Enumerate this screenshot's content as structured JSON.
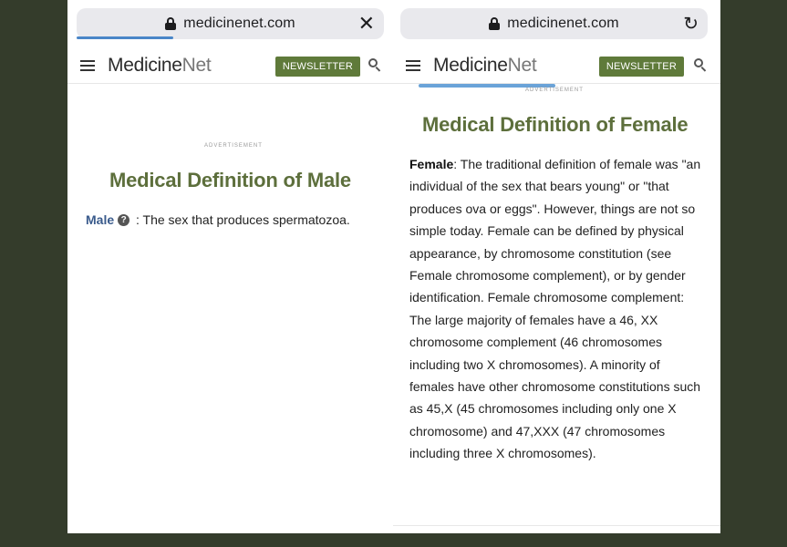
{
  "left": {
    "url": "medicinenet.com",
    "action_icon": "close-icon",
    "action_glyph": "✕",
    "site": {
      "logo_bold": "Medicine",
      "logo_thin": "Net",
      "newsletter": "NEWSLETTER"
    },
    "ad_label": "ADVERTISEMENT",
    "title": "Medical Definition of Male",
    "definition": {
      "term": "Male",
      "help_glyph": "?",
      "text": " : The sex that produces spermatozoa."
    }
  },
  "right": {
    "url": "medicinenet.com",
    "action_icon": "reload-icon",
    "action_glyph": "↻",
    "site": {
      "logo_bold": "Medicine",
      "logo_thin": "Net",
      "newsletter": "NEWSLETTER"
    },
    "ad_label": "ADVERTISEMENT",
    "title": "Medical Definition of Female",
    "definition": {
      "term": "Female",
      "text": ": The traditional definition of female was \"an individual of the sex that bears young\" or \"that produces ova or eggs\". However, things are not so simple today. Female can be defined by physical appearance, by chromosome constitution (see Female chromosome complement), or by gender identification. Female chromosome complement: The large majority of females have a 46, XX chromosome complement (46 chromosomes including two X chromosomes). A minority of females have other chromosome constitutions such as 45,X (45 chromosomes including only one X chromosome) and 47,XXX (47 chromosomes including three X chromosomes)."
    }
  },
  "colors": {
    "brand_green": "#5f7a3a",
    "title_green": "#5d6f3c",
    "link_blue": "#3a5b8c",
    "frame_bg": "#343c2b"
  }
}
